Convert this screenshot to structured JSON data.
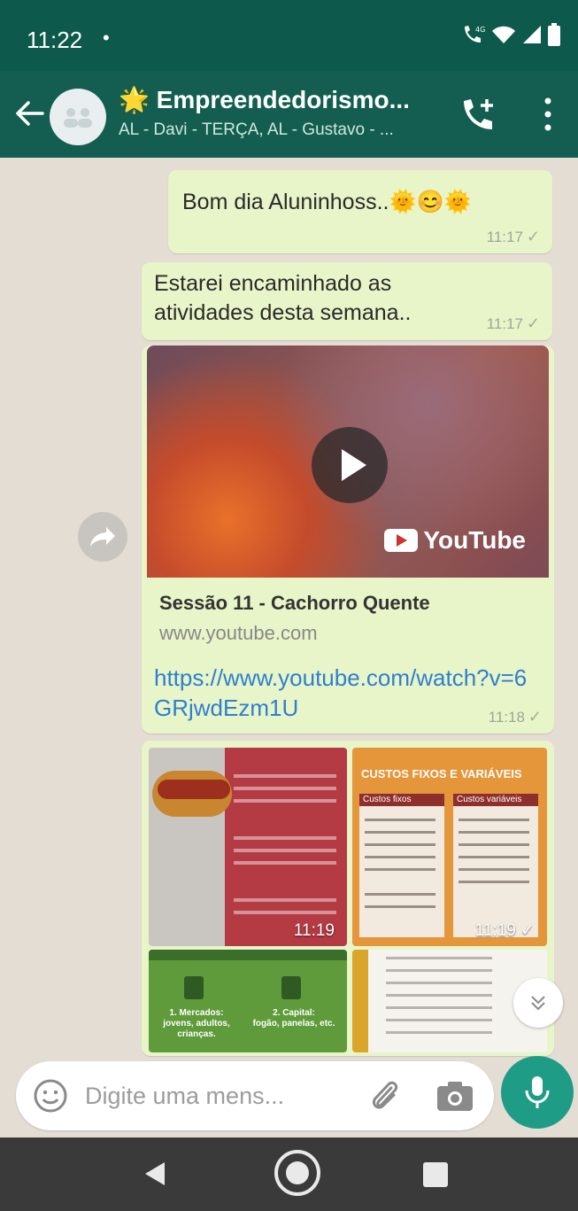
{
  "status_bar": {
    "time": "11:22",
    "dot": "•",
    "network": "4G"
  },
  "header": {
    "title": "Empreendedorismo...",
    "subtitle": "AL - Davi - TERÇA, AL - Gustavo - ...",
    "title_emoji": "🌟"
  },
  "messages": [
    {
      "text": "Bom dia Aluninhoss..",
      "emojis": "🌞😊🌞",
      "time": "11:17"
    },
    {
      "text": "Estarei encaminhado as atividades desta semana..",
      "time": "11:17"
    },
    {
      "link_title": "Sessão 11 - Cachorro Quente",
      "link_domain": "www.youtube.com",
      "url": "https://www.youtube.com/watch?v=6GRjwdEzm1U",
      "brand": "YouTube",
      "time": "11:18"
    },
    {
      "images": [
        {
          "time": "11:19"
        },
        {
          "heading": "CUSTOS FIXOS E VARIÁVEIS",
          "col1": "Custos fixos",
          "col2": "Custos variáveis",
          "time": "11:19"
        },
        {
          "label1": "1. Mercados:",
          "label1_sub": "jovens, adultos, crianças.",
          "label2": "2. Capital:",
          "label2_sub": "fogão, panelas, etc."
        },
        {}
      ]
    }
  ],
  "composer": {
    "placeholder": "Digite uma mens..."
  },
  "colors": {
    "header": "#135e50",
    "bubble": "#e8f5c8",
    "link": "#2d7fd0",
    "mic": "#1f9c86"
  }
}
